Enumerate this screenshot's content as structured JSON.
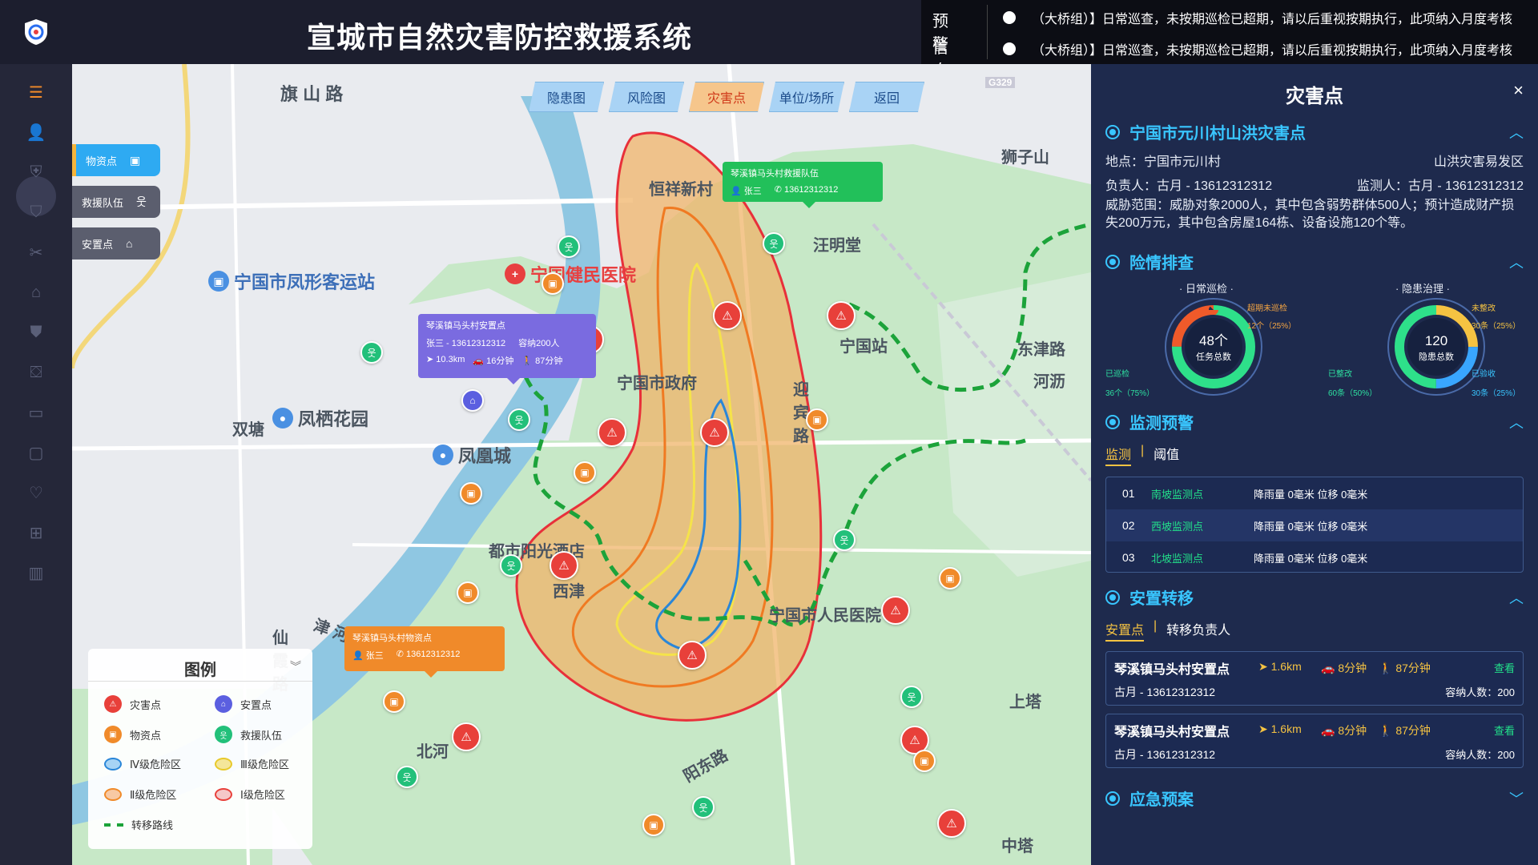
{
  "header": {
    "title": "宣城市自然灾害防控救援系统",
    "alert_label_1": "预警",
    "alert_label_2": "信息",
    "alerts": [
      "（大桥组）】日常巡查，未按期巡检已超期，请以后重视按期执行，此项纳入月度考核",
      "（大桥组）】日常巡查，未按期巡检已超期，请以后重视按期执行，此项纳入月度考核"
    ]
  },
  "sidebar": {
    "icons": [
      "menu-icon",
      "user-icon",
      "shield-icon",
      "shield-check-icon",
      "tools-icon",
      "building-icon",
      "shield-outline-icon",
      "shield-alert-icon",
      "toolbox-icon",
      "monitor-icon",
      "heart-shield-icon",
      "first-aid-icon",
      "library-icon"
    ]
  },
  "map": {
    "tabs": [
      "隐患图",
      "风险图",
      "灾害点",
      "单位/场所",
      "返回"
    ],
    "active_tab": "灾害点",
    "layers": [
      {
        "label": "物资点",
        "color": "#2eaaf2",
        "icon": "box-icon"
      },
      {
        "label": "救援队伍",
        "color": "#5b5e6e",
        "icon": "people-icon"
      },
      {
        "label": "安置点",
        "color": "#5b5e6e",
        "icon": "home-icon"
      }
    ],
    "labels": [
      {
        "text": "旗 山 路",
        "key": "road-qishan"
      },
      {
        "text": "双塘",
        "key": "area-shuangtang"
      },
      {
        "text": "恒祥新村",
        "key": "area-hengxiang"
      },
      {
        "text": "汪明堂",
        "key": "area-wangmingtang"
      },
      {
        "text": "宁国市政府",
        "key": "poi-gov"
      },
      {
        "text": "都市阳光酒店",
        "key": "poi-hotel"
      },
      {
        "text": "西津",
        "key": "area-xijin"
      },
      {
        "text": "北河",
        "key": "area-beihe"
      },
      {
        "text": "津 河 西 路",
        "key": "road-jinhe"
      },
      {
        "text": "仙 霞 路",
        "key": "road-xianxia"
      },
      {
        "text": "宁国市人民医院",
        "key": "poi-people-hospital"
      },
      {
        "text": "迎 宾 路",
        "key": "road-yingbin"
      },
      {
        "text": "宁国站",
        "key": "poi-station"
      },
      {
        "text": "东津路",
        "key": "road-dongjin"
      },
      {
        "text": "阳东路",
        "key": "road-yangdong"
      },
      {
        "text": "中塔",
        "key": "area-zhongta"
      },
      {
        "text": "上塔",
        "key": "area-shangta"
      },
      {
        "text": "狮子山",
        "key": "area-shizi"
      },
      {
        "text": "河沥",
        "key": "area-heli"
      },
      {
        "text": "G329",
        "key": "road-g329"
      }
    ],
    "pois": [
      {
        "text": "宁国市凤形客运站",
        "key": "poi-bus"
      },
      {
        "text": "宁国健民医院",
        "key": "poi-jianmin"
      },
      {
        "text": "凤栖花园",
        "key": "poi-fengqi"
      },
      {
        "text": "凤凰城",
        "key": "poi-fenghuang"
      }
    ],
    "popups": {
      "rescue": {
        "title": "琴溪镇马头村救援队伍",
        "person": "张三",
        "phone": "13612312312"
      },
      "shelter": {
        "title": "琴溪镇马头村安置点",
        "person": "张三 - 13612312312",
        "capacity": "容纳200人",
        "distance": "10.3km",
        "drive": "16分钟",
        "walk": "87分钟"
      },
      "supply": {
        "title": "琴溪镇马头村物资点",
        "person": "张三",
        "phone": "13612312312"
      }
    },
    "legend": {
      "title": "图例",
      "items": [
        {
          "label": "灾害点",
          "kind": "disaster",
          "color": "#e8403a"
        },
        {
          "label": "安置点",
          "kind": "shelter",
          "color": "#5b5fe0"
        },
        {
          "label": "物资点",
          "kind": "supply",
          "color": "#f08a2a"
        },
        {
          "label": "救援队伍",
          "kind": "rescue",
          "color": "#22c07a"
        },
        {
          "label": "Ⅳ级危险区",
          "kind": "zone",
          "color": "#a7d4f5",
          "border": "#2a86d8"
        },
        {
          "label": "Ⅲ级危险区",
          "kind": "zone",
          "color": "#f4e69a",
          "border": "#e8c92a"
        },
        {
          "label": "Ⅱ级危险区",
          "kind": "zone",
          "color": "#f8c9a4",
          "border": "#f08a2a"
        },
        {
          "label": "Ⅰ级危险区",
          "kind": "zone",
          "color": "#f5c8c8",
          "border": "#e8403a"
        },
        {
          "label": "转移路线",
          "kind": "route",
          "color": "#1ca33a"
        }
      ]
    }
  },
  "panel": {
    "title": "灾害点",
    "close": "×",
    "point": {
      "name": "宁国市元川村山洪灾害点",
      "location": "地点：宁国市元川村",
      "type": "山洪灾害易发区",
      "owner": "负责人：古月 - 13612312312",
      "monitor": "监测人：古月 - 13612312312",
      "threat": "威胁范围：威胁对象2000人，其中包含弱势群体500人；预计造成财产损失200万元，其中包含房屋164栋、设备设施120个等。"
    },
    "inspection": {
      "title": "险情排查",
      "daily": {
        "label": "日常巡检",
        "center_value": "48个",
        "center_label": "任务总数",
        "overdue_label": "超期未巡检",
        "overdue_value": "12个（25%）",
        "done_label": "已巡检",
        "done_value": "36个（75%）",
        "overdue_pct": 25
      },
      "hazard": {
        "label": "隐患治理",
        "center_value": "120",
        "center_label": "隐患总数",
        "unfixed_label": "未整改",
        "unfixed_value": "30条（25%）",
        "fixed_label": "已整改",
        "fixed_value": "60条（50%）",
        "accepted_label": "已验收",
        "accepted_value": "30条（25%）",
        "unfixed_pct": 25,
        "fixed_pct": 50,
        "accepted_pct": 25
      }
    },
    "monitoring": {
      "title": "监测预警",
      "tab_on": "监测",
      "tab_off": "阈值",
      "rows": [
        {
          "no": "01",
          "name": "南坡监测点",
          "value": "降雨量 0毫米  位移 0毫米"
        },
        {
          "no": "02",
          "name": "西坡监测点",
          "value": "降雨量 0毫米  位移 0毫米"
        },
        {
          "no": "03",
          "name": "北坡监测点",
          "value": "降雨量 0毫米  位移 0毫米"
        }
      ]
    },
    "relocation": {
      "title": "安置转移",
      "tab_on": "安置点",
      "tab_off": "转移负责人",
      "cards": [
        {
          "name": "琴溪镇马头村安置点",
          "distance": "1.6km",
          "drive": "8分钟",
          "walk": "87分钟",
          "person": "古月 - 13612312312",
          "link": "查看",
          "capacity": "容纳人数：200"
        },
        {
          "name": "琴溪镇马头村安置点",
          "distance": "1.6km",
          "drive": "8分钟",
          "walk": "87分钟",
          "person": "古月 - 13612312312",
          "link": "查看",
          "capacity": "容纳人数：200"
        }
      ]
    },
    "emergency": {
      "title": "应急预案"
    }
  }
}
